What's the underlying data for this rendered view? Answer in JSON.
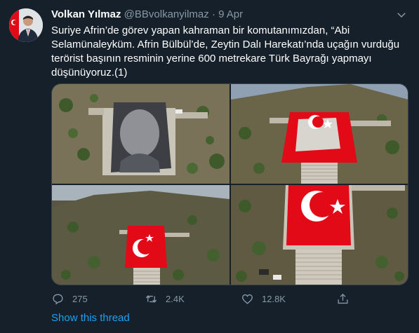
{
  "tweet": {
    "author_name": "Volkan Yılmaz",
    "handle": "@BBvolkanyilmaz",
    "separator": "·",
    "date": "9 Apr",
    "text": "Suriye Afrin’de görev yapan kahraman bir komutanımızdan, “Abi Selamünaleyküm. Afrin Bülbül’de, Zeytin Dalı Harekatı’nda uçağın vurduğu terörist başının resminin yerine 600 metrekare Türk Bayrağı yapmayı düşünüyoruz.(1)",
    "media": [
      {
        "name": "photo-1"
      },
      {
        "name": "photo-2"
      },
      {
        "name": "photo-3"
      },
      {
        "name": "photo-4"
      }
    ],
    "actions": {
      "reply_count": "275",
      "retweet_count": "2.4K",
      "like_count": "12.8K"
    },
    "show_thread": "Show this thread"
  },
  "colors": {
    "background": "#15202b",
    "secondary_text": "#8899a6",
    "link": "#1da1f2",
    "flag_red": "#e30a17",
    "border": "#38444d"
  },
  "icons": [
    "chevron-down-icon",
    "reply-icon",
    "retweet-icon",
    "like-icon",
    "share-icon"
  ]
}
